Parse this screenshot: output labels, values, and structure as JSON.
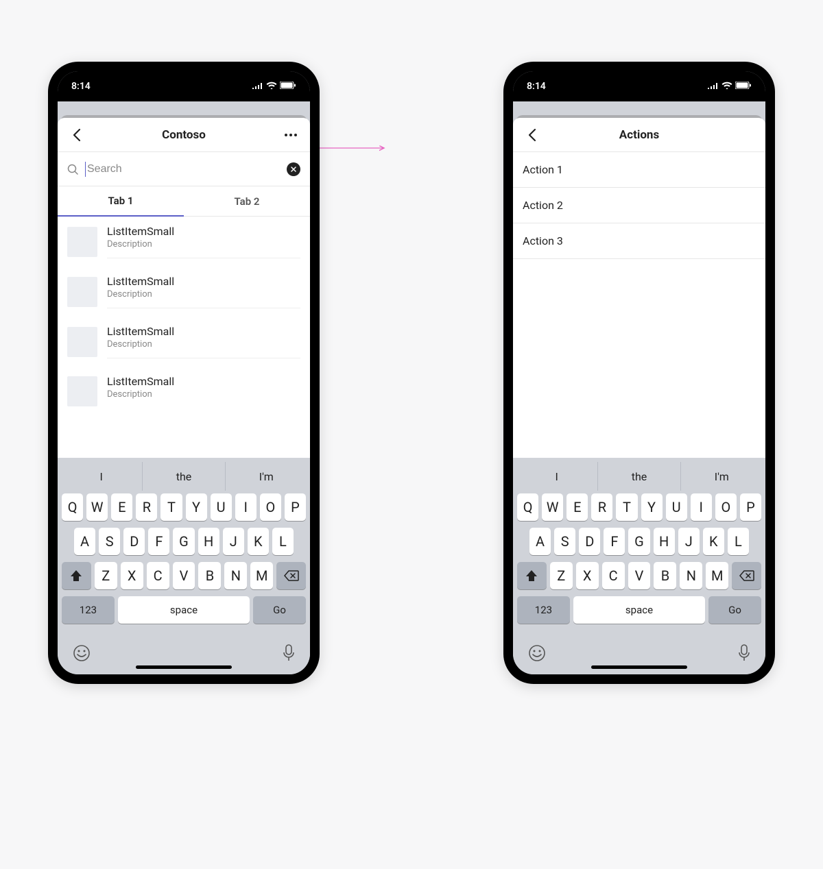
{
  "status": {
    "time": "8:14"
  },
  "screen1": {
    "nav_title": "Contoso",
    "search_placeholder": "Search",
    "tabs": [
      {
        "label": "Tab 1",
        "active": true
      },
      {
        "label": "Tab 2",
        "active": false
      }
    ],
    "list_items": [
      {
        "title": "ListItemSmall",
        "desc": "Description"
      },
      {
        "title": "ListItemSmall",
        "desc": "Description"
      },
      {
        "title": "ListItemSmall",
        "desc": "Description"
      },
      {
        "title": "ListItemSmall",
        "desc": "Description"
      }
    ]
  },
  "screen2": {
    "nav_title": "Actions",
    "actions": [
      {
        "label": "Action 1"
      },
      {
        "label": "Action 2"
      },
      {
        "label": "Action 3"
      }
    ]
  },
  "keyboard": {
    "suggestions": [
      "I",
      "the",
      "I'm"
    ],
    "row1": [
      "Q",
      "W",
      "E",
      "R",
      "T",
      "Y",
      "U",
      "I",
      "O",
      "P"
    ],
    "row2": [
      "A",
      "S",
      "D",
      "F",
      "G",
      "H",
      "J",
      "K",
      "L"
    ],
    "row3": [
      "Z",
      "X",
      "C",
      "V",
      "B",
      "N",
      "M"
    ],
    "num_key": "123",
    "space_key": "space",
    "go_key": "Go"
  }
}
